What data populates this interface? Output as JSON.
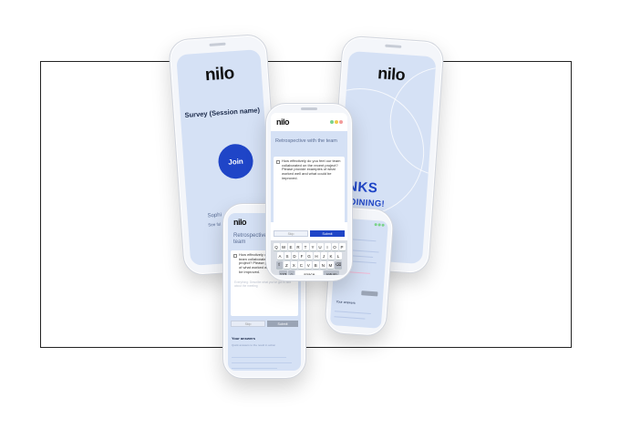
{
  "brand": {
    "logo": "nilo",
    "accent": "#1f45c7",
    "screen_bg": "#d5e1f5"
  },
  "phone_join": {
    "survey_title": "Survey (Session name)",
    "join_label": "Join",
    "user_name": "Sophi",
    "user_sub": "See ful"
  },
  "phone_thanks": {
    "line1": "HANKS",
    "line2": "R JOINING!"
  },
  "phone_question": {
    "title": "Retrospective with the team",
    "question": "How effectively do you feel our team collaborated on the recent project? Please provide examples of what worked well and what could be improved.",
    "placeholder": "Everything: Describe what you've got to add about the meeting",
    "skip_label": "Skip",
    "submit_label": "Submit",
    "answers_label": "Your answers",
    "answers_hint": "Quick answers to the result in action"
  },
  "phone_question_d": {
    "title": "Retrospective with the team",
    "question": "How effectively do you feel our team collaborated on the recent project? Please provide examples of what worked well and what could be improved."
  },
  "keyboard": {
    "row1": [
      "Q",
      "W",
      "E",
      "R",
      "T",
      "Y",
      "U",
      "I",
      "O",
      "P"
    ],
    "row2": [
      "A",
      "S",
      "D",
      "F",
      "G",
      "H",
      "J",
      "K",
      "L"
    ],
    "row3": [
      "Z",
      "X",
      "C",
      "V",
      "B",
      "N",
      "M"
    ],
    "shift": "⇧",
    "backspace": "⌫",
    "numbers": "123",
    "emoji": "☺",
    "space": "space",
    "return": "return"
  },
  "status_colors": [
    "#7bd38a",
    "#f2c94c",
    "#f29c9c"
  ]
}
